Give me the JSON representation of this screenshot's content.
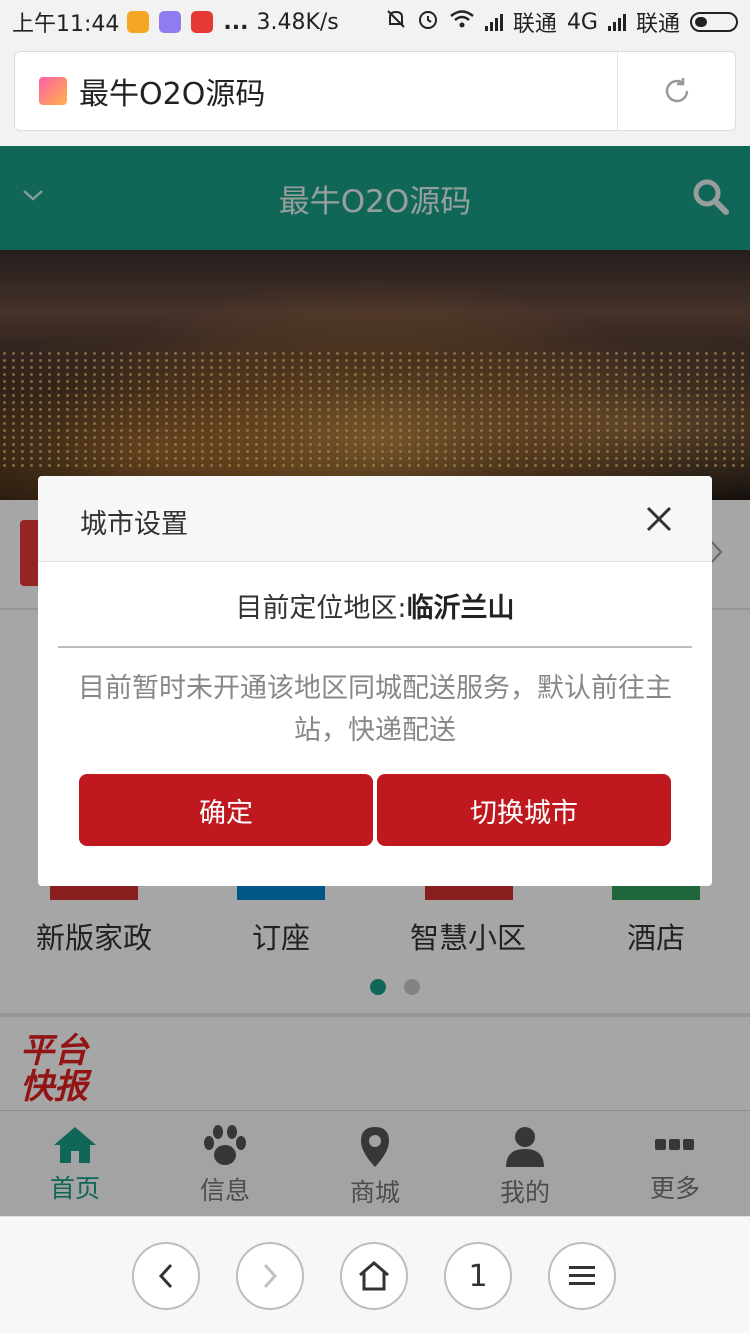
{
  "status_bar": {
    "time": "上午11:44",
    "more": "...",
    "speed": "3.48K/s",
    "carrier1": "联通",
    "network": "4G",
    "carrier2": "联通"
  },
  "browser": {
    "page_title": "最牛O2O源码"
  },
  "header": {
    "title": "最牛O2O源码"
  },
  "categories": [
    {
      "label": "新版家政",
      "color": "#d32f2f"
    },
    {
      "label": "订座",
      "color": "#0288d1"
    },
    {
      "label": "智慧小区",
      "color": "#d32f2f"
    },
    {
      "label": "酒店",
      "color": "#2e9e5b"
    }
  ],
  "news": {
    "logo_text": "平台快报"
  },
  "tabs": [
    {
      "label": "首页",
      "icon": "home-icon",
      "active": true
    },
    {
      "label": "信息",
      "icon": "paw-icon",
      "active": false
    },
    {
      "label": "商城",
      "icon": "location-pin-icon",
      "active": false
    },
    {
      "label": "我的",
      "icon": "user-icon",
      "active": false
    },
    {
      "label": "更多",
      "icon": "more-icon",
      "active": false
    }
  ],
  "dialog": {
    "title": "城市设置",
    "location_label": "目前定位地区:",
    "location_value": "临沂兰山",
    "message": "目前暂时未开通该地区同城配送服务，默认前往主站，快递配送",
    "confirm_label": "确定",
    "switch_label": "切换城市"
  },
  "browser_nav": {
    "tab_count": "1"
  },
  "colors": {
    "brand": "#1a9e88",
    "button": "#c0181f"
  }
}
